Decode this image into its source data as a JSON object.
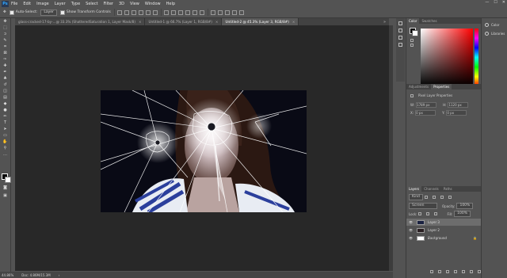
{
  "app": {
    "logo": "Ps"
  },
  "menu": [
    "File",
    "Edit",
    "Image",
    "Layer",
    "Type",
    "Select",
    "Filter",
    "3D",
    "View",
    "Window",
    "Help"
  ],
  "window_controls": [
    "—",
    "☐",
    "✕"
  ],
  "options": {
    "auto_select_label": "Auto-Select:",
    "auto_select_value": "Layer",
    "transform_label": "Show Transform Controls"
  },
  "tabs": [
    {
      "label": "glass-cracked-17-by-...@ 33.3% (ShatteredSaturation 1, Layer Mask/8)",
      "active": false
    },
    {
      "label": "Untitled-1 @ 66.7% (Layer 1, RGB/8#)",
      "active": false
    },
    {
      "label": "Untitled-2 @ 45.3% (Layer 3, RGB/8#)",
      "active": true
    }
  ],
  "status": {
    "zoom": "44.86%",
    "doc": "Doc: 4.86M/15.3M"
  },
  "color_panel": {
    "tabs": [
      "Color",
      "Swatches"
    ]
  },
  "props_panel": {
    "tabs": [
      "Adjustments",
      "Properties"
    ],
    "heading": "Pixel Layer Properties",
    "w_label": "W:",
    "w_value": "1789 px",
    "h_label": "H:",
    "h_value": "1120 px",
    "x_label": "X:",
    "x_value": "0 px",
    "y_label": "Y:",
    "y_value": "0 px"
  },
  "layers_panel": {
    "tabs": [
      "Layers",
      "Channels",
      "Paths"
    ],
    "kind": "Kind",
    "blend": "Screen",
    "opacity_label": "Opacity:",
    "opacity_value": "100%",
    "lock_label": "Lock:",
    "fill_label": "Fill:",
    "fill_value": "100%",
    "layers": [
      {
        "name": "Layer 3",
        "selected": true
      },
      {
        "name": "Layer 2",
        "selected": false
      },
      {
        "name": "Background",
        "selected": false
      }
    ]
  },
  "libraries": [
    "Color",
    "Libraries"
  ]
}
